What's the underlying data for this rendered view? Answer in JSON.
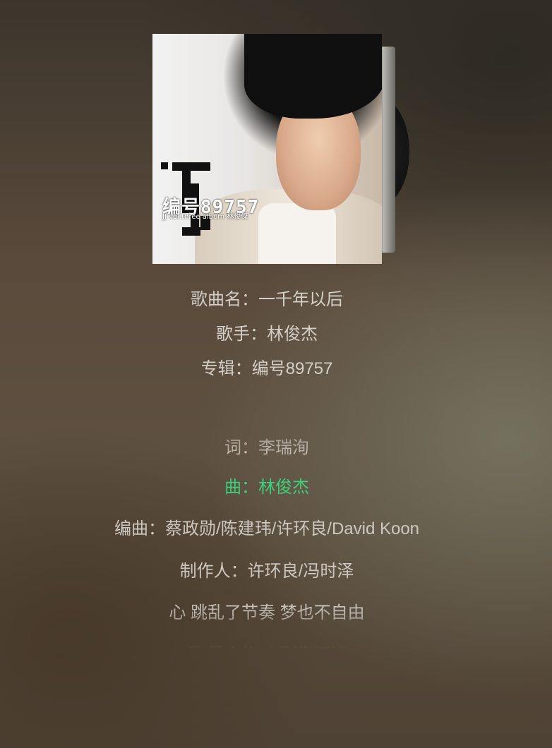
{
  "song": {
    "title_line": "歌曲名：一千年以后",
    "artist_line": "歌手：林俊杰",
    "album_line": "专辑：编号89757"
  },
  "cover": {
    "album_number": "编号89757",
    "album_subtitle": "JJ vol.three album 林俊傑"
  },
  "lyrics": [
    {
      "text": "词：李瑞洵",
      "active": false
    },
    {
      "text": "曲：林俊杰",
      "active": true
    },
    {
      "text": "编曲：蔡政勋/陈建玮/许环良/David Koon",
      "active": false
    },
    {
      "text": "制作人：许环良/冯时泽",
      "active": false
    },
    {
      "text": "心 跳乱了节奏 梦也不自由",
      "active": false
    },
    {
      "text": "爱 是个绝对承诺 不说",
      "active": false
    }
  ],
  "colors": {
    "active_lyric": "#3ed07a",
    "lyric": "#cdc8c0"
  }
}
